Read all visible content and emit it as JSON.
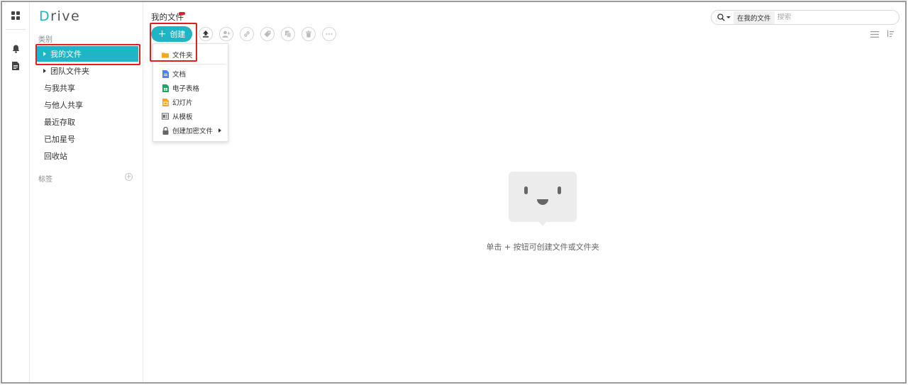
{
  "app": {
    "logo_initial": "D",
    "logo_rest": "rive"
  },
  "rail": {
    "icons": [
      "apps-grid-icon",
      "bell-icon",
      "document-icon"
    ]
  },
  "sidebar": {
    "category_label": "类别",
    "items": [
      {
        "label": "我的文件",
        "active": true,
        "expandable": true
      },
      {
        "label": "团队文件夹",
        "active": false,
        "expandable": true
      },
      {
        "label": "与我共享",
        "active": false,
        "expandable": false
      },
      {
        "label": "与他人共享",
        "active": false,
        "expandable": false
      },
      {
        "label": "最近存取",
        "active": false,
        "expandable": false
      },
      {
        "label": "已加星号",
        "active": false,
        "expandable": false
      },
      {
        "label": "回收站",
        "active": false,
        "expandable": false
      }
    ],
    "tags_label": "标签",
    "tags_add_icon": "plus-circle-icon"
  },
  "main": {
    "title": "我的文件",
    "toolbar": {
      "create_plus": "+",
      "create_label": "创建",
      "tools": [
        "upload-icon",
        "add-user-icon",
        "link-icon",
        "tag-icon",
        "copy-icon",
        "trash-icon",
        "more-icon"
      ]
    },
    "search": {
      "scope": "在我的文件",
      "placeholder": "搜索"
    },
    "create_menu": {
      "items": [
        {
          "label": "文件夹",
          "icon": "folder-icon",
          "color": "#f5a623"
        },
        {
          "label": "文档",
          "icon": "doc-icon",
          "color": "#4a86e8"
        },
        {
          "label": "电子表格",
          "icon": "sheet-icon",
          "color": "#1fa463"
        },
        {
          "label": "幻灯片",
          "icon": "slides-icon",
          "color": "#f5a623"
        },
        {
          "label": "从模板",
          "icon": "template-icon",
          "color": "#555555"
        },
        {
          "label": "创建加密文件",
          "icon": "lock-icon",
          "color": "#666666"
        }
      ]
    },
    "empty_state": {
      "message": "单击 + 按钮可创建文件或文件夹"
    }
  },
  "colors": {
    "accent": "#1fb5c6",
    "highlight_box": "#e02020"
  }
}
